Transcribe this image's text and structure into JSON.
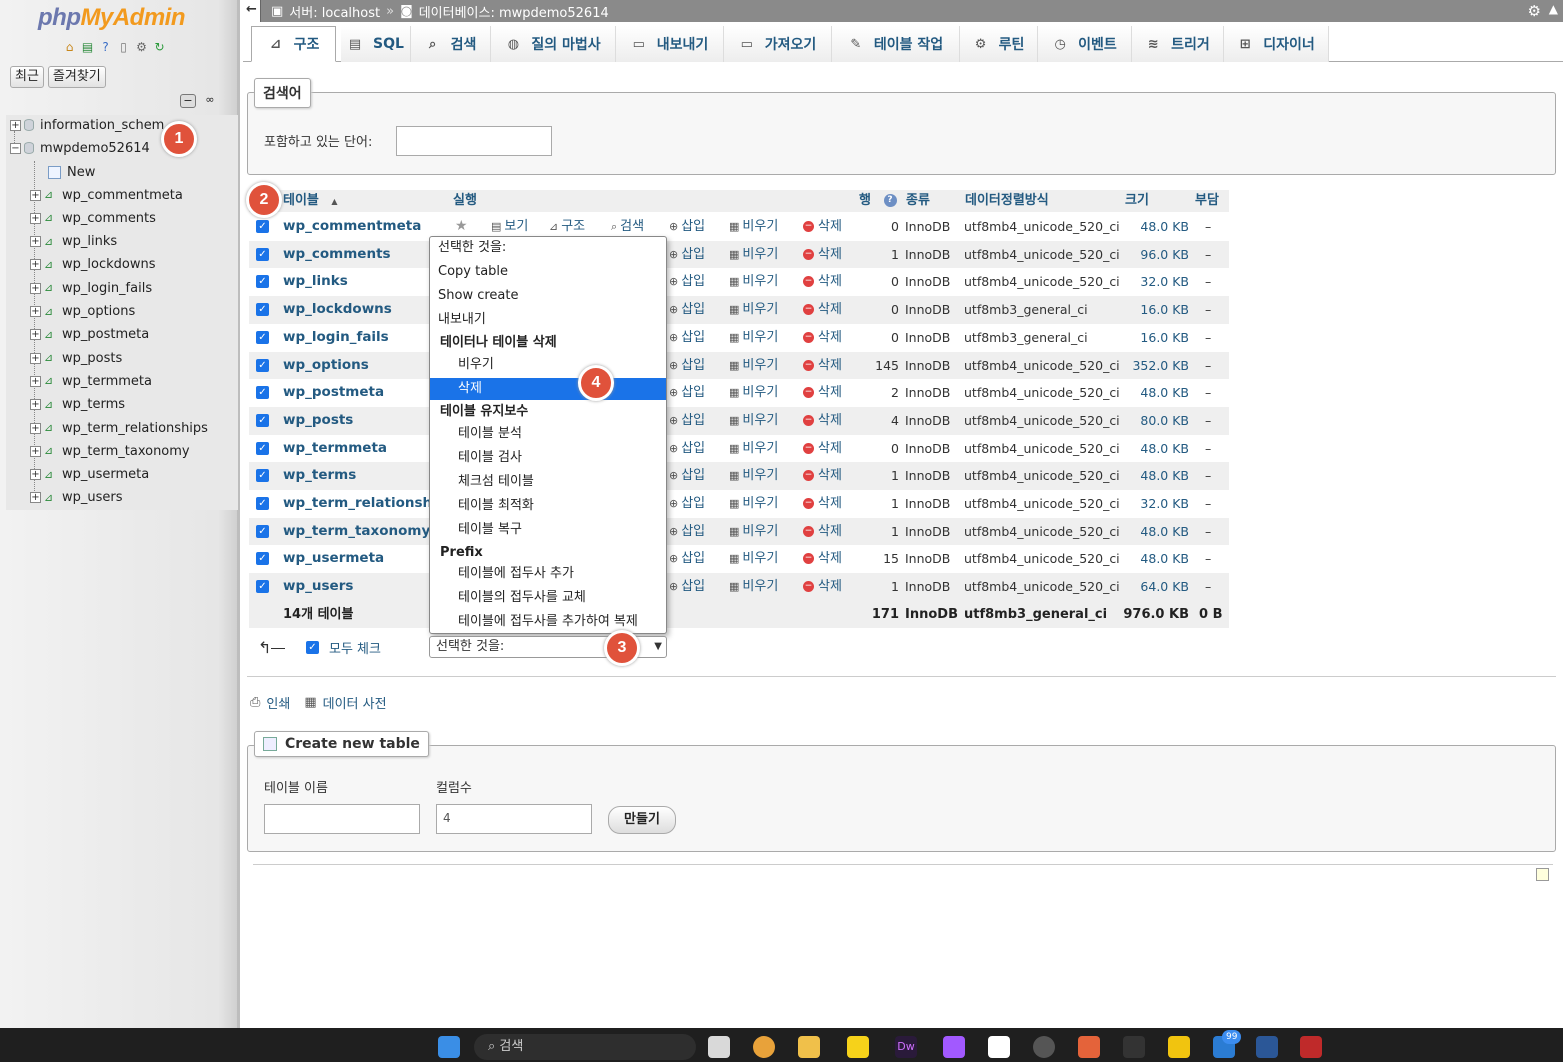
{
  "sidebar": {
    "logo_php": "php",
    "logo_admin": "MyAdmin",
    "btn_recent": "최근",
    "btn_favorites": "즐겨찾기",
    "databases": [
      {
        "name": "information_schema_display",
        "label": "information_schem"
      },
      {
        "name": "mwpdemo52614",
        "label": "mwpdemo52614"
      }
    ],
    "new_label": "New",
    "tables": [
      "wp_commentmeta",
      "wp_comments",
      "wp_links",
      "wp_lockdowns",
      "wp_login_fails",
      "wp_options",
      "wp_postmeta",
      "wp_posts",
      "wp_termmeta",
      "wp_terms",
      "wp_term_relationships",
      "wp_term_taxonomy",
      "wp_usermeta",
      "wp_users"
    ]
  },
  "topbar": {
    "server": "서버: localhost",
    "database": "데이터베이스: mwpdemo52614",
    "separator": "»"
  },
  "menu_tabs": [
    {
      "label": "구조",
      "icon": "structure-icon"
    },
    {
      "label": "SQL",
      "icon": "sql-icon"
    },
    {
      "label": "검색",
      "icon": "search-icon"
    },
    {
      "label": "질의 마법사",
      "icon": "query-icon"
    },
    {
      "label": "내보내기",
      "icon": "export-icon"
    },
    {
      "label": "가져오기",
      "icon": "import-icon"
    },
    {
      "label": "테이블 작업",
      "icon": "wrench-icon"
    },
    {
      "label": "루틴",
      "icon": "routines-icon"
    },
    {
      "label": "이벤트",
      "icon": "events-icon"
    },
    {
      "label": "트리거",
      "icon": "triggers-icon"
    },
    {
      "label": "디자이너",
      "icon": "designer-icon"
    }
  ],
  "search": {
    "legend": "검색어",
    "label": "포함하고 있는 단어:",
    "value": ""
  },
  "table": {
    "headers": {
      "name": "테이블",
      "action": "실행",
      "rows": "행",
      "type": "종류",
      "collation": "데이터정렬방식",
      "size": "크기",
      "overhead": "부담"
    },
    "action_labels": {
      "browse": "보기",
      "structure": "구조",
      "search": "검색",
      "insert": "삽입",
      "empty": "비우기",
      "drop": "삭제"
    },
    "rows": [
      {
        "name": "wp_commentmeta",
        "rows": "0",
        "type": "InnoDB",
        "collation": "utf8mb4_unicode_520_ci",
        "size": "48.0 KB",
        "overhead": "–"
      },
      {
        "name": "wp_comments",
        "rows": "1",
        "type": "InnoDB",
        "collation": "utf8mb4_unicode_520_ci",
        "size": "96.0 KB",
        "overhead": "–"
      },
      {
        "name": "wp_links",
        "rows": "0",
        "type": "InnoDB",
        "collation": "utf8mb4_unicode_520_ci",
        "size": "32.0 KB",
        "overhead": "–"
      },
      {
        "name": "wp_lockdowns",
        "rows": "0",
        "type": "InnoDB",
        "collation": "utf8mb3_general_ci",
        "size": "16.0 KB",
        "overhead": "–"
      },
      {
        "name": "wp_login_fails",
        "rows": "0",
        "type": "InnoDB",
        "collation": "utf8mb3_general_ci",
        "size": "16.0 KB",
        "overhead": "–"
      },
      {
        "name": "wp_options",
        "rows": "145",
        "type": "InnoDB",
        "collation": "utf8mb4_unicode_520_ci",
        "size": "352.0 KB",
        "overhead": "–"
      },
      {
        "name": "wp_postmeta",
        "rows": "2",
        "type": "InnoDB",
        "collation": "utf8mb4_unicode_520_ci",
        "size": "48.0 KB",
        "overhead": "–"
      },
      {
        "name": "wp_posts",
        "rows": "4",
        "type": "InnoDB",
        "collation": "utf8mb4_unicode_520_ci",
        "size": "80.0 KB",
        "overhead": "–"
      },
      {
        "name": "wp_termmeta",
        "rows": "0",
        "type": "InnoDB",
        "collation": "utf8mb4_unicode_520_ci",
        "size": "48.0 KB",
        "overhead": "–"
      },
      {
        "name": "wp_terms",
        "rows": "1",
        "type": "InnoDB",
        "collation": "utf8mb4_unicode_520_ci",
        "size": "48.0 KB",
        "overhead": "–"
      },
      {
        "name": "wp_term_relationships",
        "rows": "1",
        "type": "InnoDB",
        "collation": "utf8mb4_unicode_520_ci",
        "size": "32.0 KB",
        "overhead": "–"
      },
      {
        "name": "wp_term_taxonomy",
        "rows": "1",
        "type": "InnoDB",
        "collation": "utf8mb4_unicode_520_ci",
        "size": "48.0 KB",
        "overhead": "–"
      },
      {
        "name": "wp_usermeta",
        "rows": "15",
        "type": "InnoDB",
        "collation": "utf8mb4_unicode_520_ci",
        "size": "48.0 KB",
        "overhead": "–"
      },
      {
        "name": "wp_users",
        "rows": "1",
        "type": "InnoDB",
        "collation": "utf8mb4_unicode_520_ci",
        "size": "64.0 KB",
        "overhead": "–"
      }
    ],
    "summary": {
      "name": "14개 테이블",
      "rows": "171",
      "type": "InnoDB",
      "collation": "utf8mb3_general_ci",
      "size": "976.0 KB",
      "overhead": "0 B"
    }
  },
  "dropdown": {
    "items": [
      {
        "label": "선택한 것을:",
        "kind": "item"
      },
      {
        "label": "Copy table",
        "kind": "item"
      },
      {
        "label": "Show create",
        "kind": "item"
      },
      {
        "label": "내보내기",
        "kind": "item"
      },
      {
        "label": "테이터나 테이블 삭제",
        "kind": "group"
      },
      {
        "label": "비우기",
        "kind": "ind"
      },
      {
        "label": "삭제",
        "kind": "sel"
      },
      {
        "label": "테이블 유지보수",
        "kind": "group"
      },
      {
        "label": "테이블 분석",
        "kind": "ind"
      },
      {
        "label": "테이블 검사",
        "kind": "ind"
      },
      {
        "label": "체크섬 테이블",
        "kind": "ind"
      },
      {
        "label": "테이블 최적화",
        "kind": "ind"
      },
      {
        "label": "테이블 복구",
        "kind": "ind"
      },
      {
        "label": "Prefix",
        "kind": "group"
      },
      {
        "label": "테이블에 접두사 추가",
        "kind": "ind"
      },
      {
        "label": "테이블의 접두사를 교체",
        "kind": "ind"
      },
      {
        "label": "테이블에 접두사를 추가하여 복제",
        "kind": "ind"
      }
    ]
  },
  "bulk": {
    "check_all": "모두 체크",
    "select_value": "선택한 것을:"
  },
  "links": {
    "print": "인쇄",
    "data_dictionary": "데이터 사전"
  },
  "create_table": {
    "legend": "Create new table",
    "name_label": "테이블 이름",
    "name_value": "",
    "columns_label": "컬럼수",
    "columns_value": "4",
    "submit": "만들기"
  },
  "badges": [
    "1",
    "2",
    "3",
    "4"
  ],
  "taskbar": {
    "search_placeholder": "검색",
    "notification_count": "99"
  },
  "colors": {
    "link": "#235a81",
    "accent": "#1a73e8",
    "badge": "#e0523b",
    "topbar": "#8a8a8a"
  }
}
